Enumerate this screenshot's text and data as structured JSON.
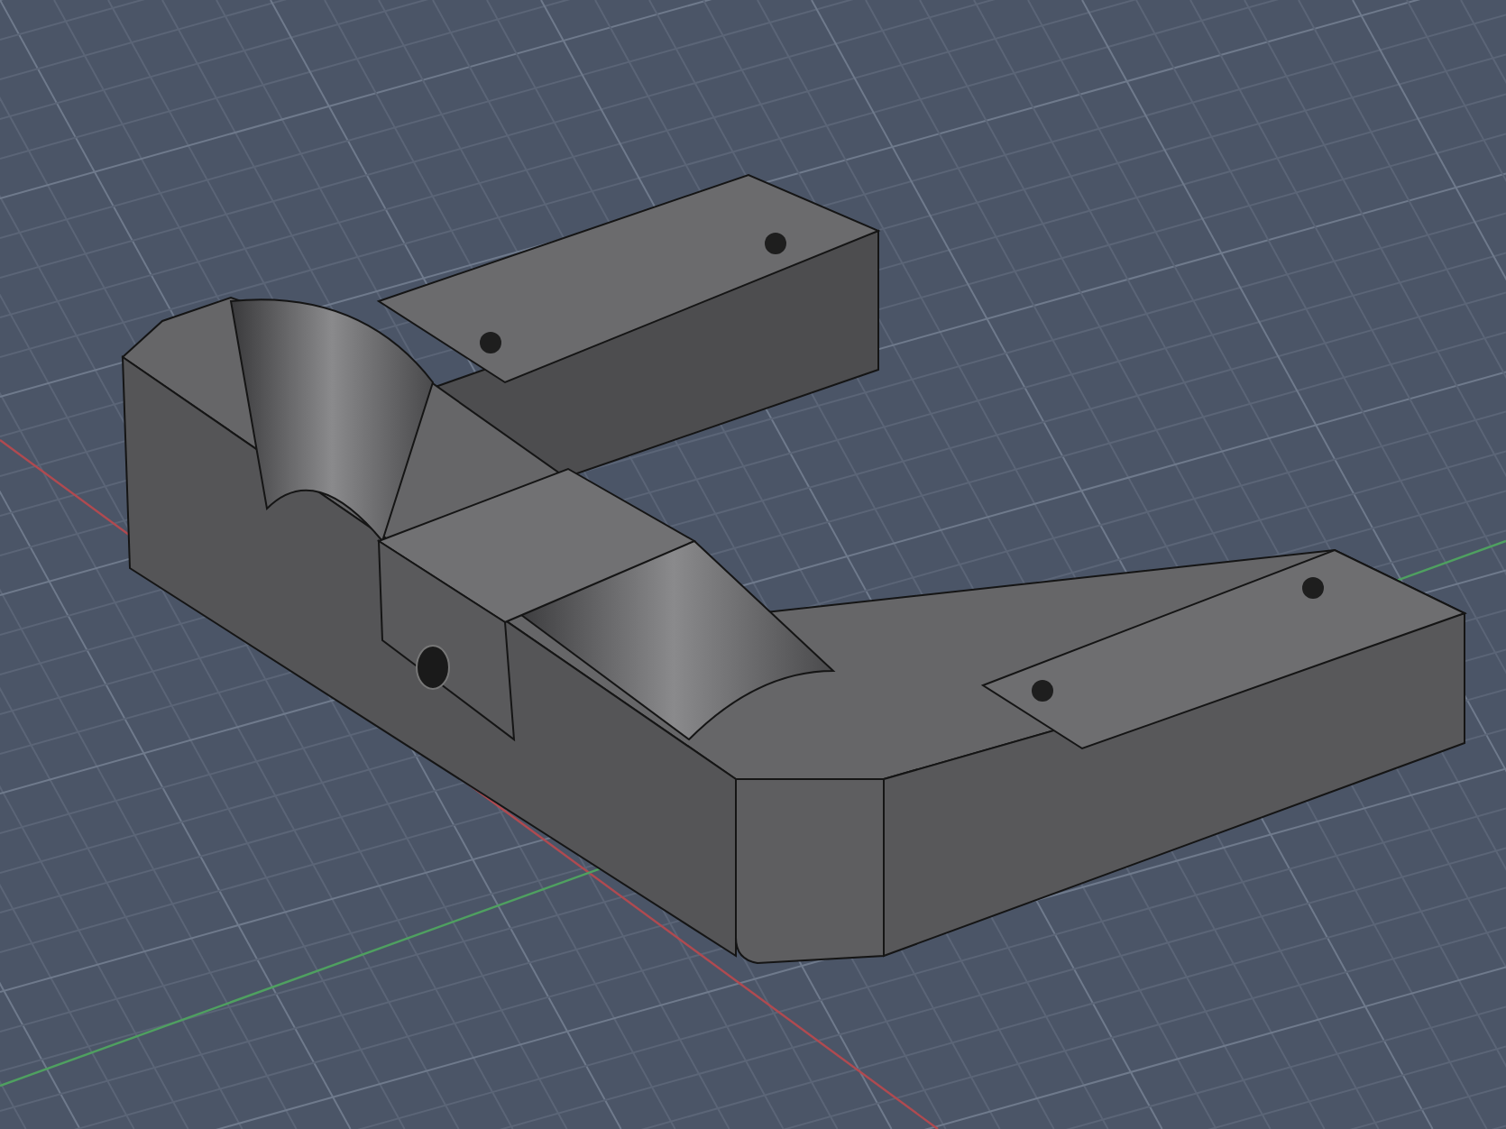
{
  "viewport": {
    "kind": "cad-3d-view"
  }
}
